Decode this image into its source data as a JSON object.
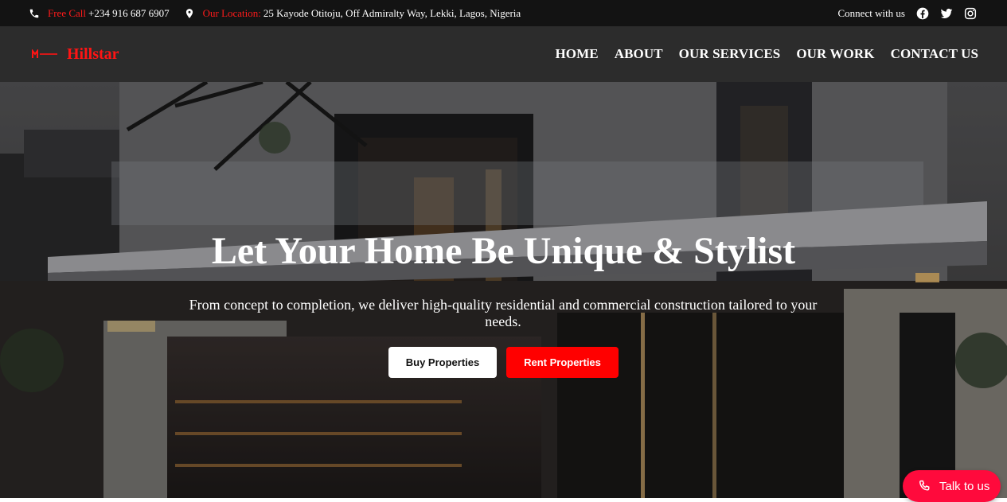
{
  "topbar": {
    "phone_label": "Free Call",
    "phone": "+234 916 687 6907",
    "location_label": "Our Location:",
    "location": "25 Kayode Otitoju, Off Admiralty Way, Lekki, Lagos, Nigeria",
    "connect": "Connect with us",
    "socials": [
      "facebook-icon",
      "twitter-icon",
      "instagram-icon"
    ]
  },
  "brand": {
    "name": "Hillstar",
    "color": "#ff1414"
  },
  "nav": {
    "items": [
      "HOME",
      "ABOUT",
      "OUR SERVICES",
      "OUR WORK",
      "CONTACT US"
    ]
  },
  "hero": {
    "title": "Let Your Home Be Unique & Stylist",
    "subtitle": "From concept to completion, we deliver high-quality residential and commercial construction tailored to your needs.",
    "buy_label": "Buy Properties",
    "rent_label": "Rent Properties"
  },
  "chat": {
    "label": "Talk to us",
    "color": "#ff0a3c"
  }
}
